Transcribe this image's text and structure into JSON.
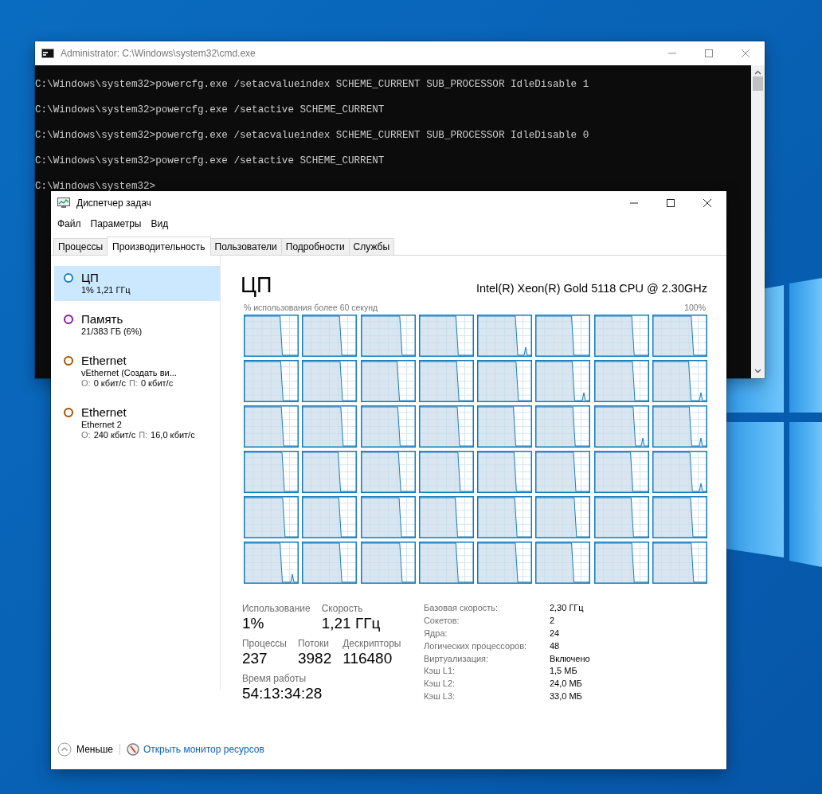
{
  "cmd_window": {
    "title": "Administrator: C:\\Windows\\system32\\cmd.exe",
    "lines": [
      "C:\\Windows\\system32>powercfg.exe /setacvalueindex SCHEME_CURRENT SUB_PROCESSOR IdleDisable 1",
      "C:\\Windows\\system32>powercfg.exe /setactive SCHEME_CURRENT",
      "C:\\Windows\\system32>powercfg.exe /setacvalueindex SCHEME_CURRENT SUB_PROCESSOR IdleDisable 0",
      "C:\\Windows\\system32>powercfg.exe /setactive SCHEME_CURRENT",
      "C:\\Windows\\system32>"
    ]
  },
  "task_manager": {
    "title": "Диспетчер задач",
    "menu": [
      "Файл",
      "Параметры",
      "Вид"
    ],
    "tabs": [
      {
        "label": "Процессы",
        "selected": false
      },
      {
        "label": "Производительность",
        "selected": true
      },
      {
        "label": "Пользователи",
        "selected": false
      },
      {
        "label": "Подробности",
        "selected": false
      },
      {
        "label": "Службы",
        "selected": false
      }
    ],
    "resources": [
      {
        "name": "ЦП",
        "color": "#1c7fc4",
        "selected": true,
        "details": [
          "1% 1,21 ГГц"
        ]
      },
      {
        "name": "Память",
        "color": "#8b12ae",
        "selected": false,
        "details": [
          "21/383 ГБ (6%)"
        ]
      },
      {
        "name": "Ethernet",
        "color": "#a74f01",
        "selected": false,
        "details": [
          "vEthernet (Создать ви..."
        ],
        "throughput": [
          {
            "label": "О:",
            "value": "0 кбит/с"
          },
          {
            "label": "П:",
            "value": "0 кбит/с"
          }
        ]
      },
      {
        "name": "Ethernet",
        "color": "#a74f01",
        "selected": false,
        "details": [
          "Ethernet 2"
        ],
        "throughput": [
          {
            "label": "О:",
            "value": "240 кбит/с"
          },
          {
            "label": "П:",
            "value": "16,0 кбит/с"
          }
        ]
      }
    ],
    "heading": "ЦП",
    "cpu_model": "Intel(R) Xeon(R) Gold 5118 CPU @ 2.30GHz",
    "graph_caption": "% использования более 60 секунд",
    "graph_max": "100%",
    "stat_rows": [
      [
        {
          "label": "Использование",
          "value": "1%"
        },
        {
          "label": "Скорость",
          "value": "1,21 ГГц"
        }
      ],
      [
        {
          "label": "Процессы",
          "value": "237"
        },
        {
          "label": "Потоки",
          "value": "3982"
        },
        {
          "label": "Дескрипторы",
          "value": "116480"
        }
      ],
      [
        {
          "label": "Время работы",
          "value": "54:13:34:28"
        }
      ]
    ],
    "specs": [
      {
        "label": "Базовая скорость:",
        "value": "2,30 ГГц"
      },
      {
        "label": "Сокетов:",
        "value": "2"
      },
      {
        "label": "Ядра:",
        "value": "24"
      },
      {
        "label": "Логических процессоров:",
        "value": "48"
      },
      {
        "label": "Виртуализация:",
        "value": "Включено"
      },
      {
        "label": "Кэш L1:",
        "value": "1,5 МБ"
      },
      {
        "label": "Кэш L2:",
        "value": "24,0 МБ"
      },
      {
        "label": "Кэш L3:",
        "value": "33,0 МБ"
      }
    ],
    "fewer_button": "Меньше",
    "monitor_link": "Открыть монитор ресурсов"
  }
}
